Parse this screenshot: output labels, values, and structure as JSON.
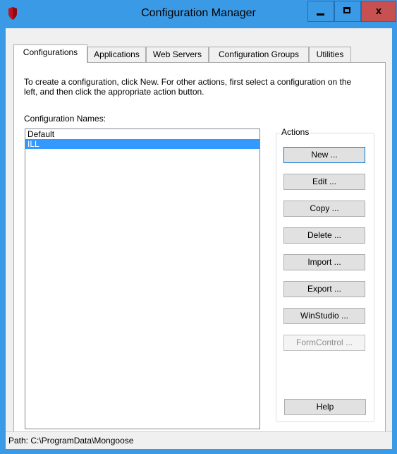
{
  "window": {
    "title": "Configuration Manager",
    "close_glyph": "x"
  },
  "tabs": [
    {
      "label": "Configurations",
      "active": true
    },
    {
      "label": "Applications"
    },
    {
      "label": "Web Servers"
    },
    {
      "label": "Configuration Groups"
    },
    {
      "label": "Utilities"
    }
  ],
  "panel": {
    "instructions": "To create a configuration, click New.  For other actions, first select a configuration on the left, and then click the appropriate action button.",
    "names_label": "Configuration Names:",
    "configurations": [
      {
        "name": "Default",
        "selected": false
      },
      {
        "name": "ILL",
        "selected": true
      }
    ]
  },
  "actions": {
    "legend": "Actions",
    "buttons": [
      {
        "label": "New ...",
        "enabled": true
      },
      {
        "label": "Edit ...",
        "enabled": true
      },
      {
        "label": "Copy ...",
        "enabled": true
      },
      {
        "label": "Delete ...",
        "enabled": true
      },
      {
        "label": "Import ...",
        "enabled": true
      },
      {
        "label": "Export ...",
        "enabled": true
      },
      {
        "label": "WinStudio ...",
        "enabled": true
      },
      {
        "label": "FormControl ...",
        "enabled": false
      }
    ],
    "help_label": "Help"
  },
  "status": {
    "path": "Path: C:\\ProgramData\\Mongoose"
  },
  "colors": {
    "titlebar": "#3b9ae6",
    "selection": "#3399ff",
    "close_button": "#c75050"
  }
}
